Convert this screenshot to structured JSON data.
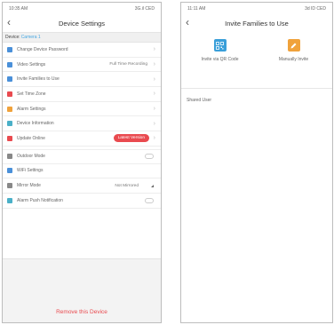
{
  "left": {
    "status": {
      "time": "10:35 AM",
      "signal": "3G.il CED"
    },
    "title": "Device Settings",
    "device": {
      "label": "Device:",
      "value": "Camera 1"
    },
    "items": [
      {
        "label": "Change Device Password",
        "color": "#4a90d9"
      },
      {
        "label": "Video Settings",
        "value": "Full Time Recording",
        "color": "#4a90d9"
      },
      {
        "label": "Invite Families to Use",
        "color": "#4a90d9"
      },
      {
        "label": "Set Time Zone",
        "color": "#e94a4f"
      },
      {
        "label": "Alarm Settings",
        "color": "#f0a23b"
      },
      {
        "label": "Device Information",
        "color": "#4ab0c8"
      },
      {
        "label": "Update Online",
        "badge": "Latest Version",
        "color": "#e94a4f"
      },
      {
        "label": "Outdoor Mode",
        "color": "#888888"
      },
      {
        "label": "WiFi Settings",
        "color": "#4a90d9"
      },
      {
        "label": "Mirror Mode",
        "value": "Not Mirrored",
        "color": "#888888"
      },
      {
        "label": "Alarm Push Notification",
        "color": "#4ab0c8"
      }
    ],
    "remove": "Remove this Device"
  },
  "right": {
    "status": {
      "time": "11:11 AM",
      "signal": "3d ID CED"
    },
    "title": "Invite Families to Use",
    "options": [
      {
        "label": "Invite via QR Code",
        "color": "#3a9fd9",
        "icon": "qr-code-icon"
      },
      {
        "label": "Manually Invite",
        "color": "#f0a23b",
        "icon": "pencil-icon"
      }
    ],
    "shared_label": "Shared User"
  }
}
